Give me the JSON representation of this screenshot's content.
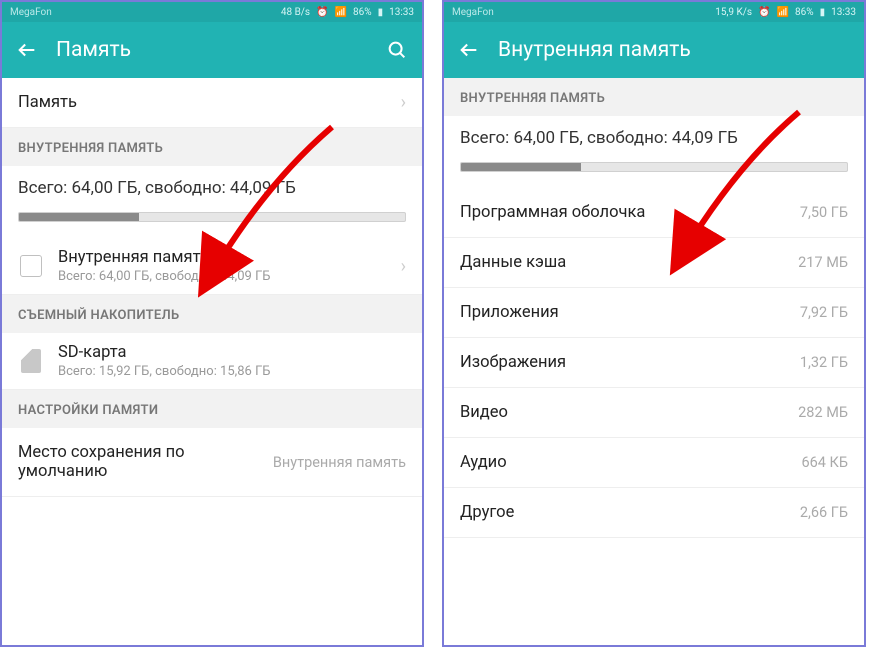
{
  "left": {
    "statusbar": {
      "carrier": "MegaFon",
      "speed": "48 B/s",
      "battery": "86%",
      "time": "13:33"
    },
    "header": {
      "title": "Память"
    },
    "row_memory": {
      "label": "Память"
    },
    "section_internal": "ВНУТРЕННЯЯ ПАМЯТЬ",
    "summary": "Всего: 64,00 ГБ, свободно: 44,09 ГБ",
    "progress_pct": 31,
    "internal_item": {
      "title": "Внутренняя память",
      "sub": "Всего: 64,00 ГБ, свободно: 44,09 ГБ"
    },
    "section_removable": "СЪЕМНЫЙ НАКОПИТЕЛЬ",
    "sd_item": {
      "title": "SD-карта",
      "sub": "Всего: 15,92 ГБ, свободно: 15,86 ГБ"
    },
    "section_settings": "НАСТРОЙКИ ПАМЯТИ",
    "default_loc": {
      "title": "Место сохранения по умолчанию",
      "value": "Внутренняя память"
    }
  },
  "right": {
    "statusbar": {
      "carrier": "MegaFon",
      "speed": "15,9 K/s",
      "battery": "86%",
      "time": "13:33"
    },
    "header": {
      "title": "Внутренняя память"
    },
    "section_internal": "ВНУТРЕННЯЯ ПАМЯТЬ",
    "summary": "Всего: 64,00 ГБ, свободно: 44,09 ГБ",
    "progress_pct": 31,
    "items": [
      {
        "label": "Программная оболочка",
        "value": "7,50 ГБ"
      },
      {
        "label": "Данные кэша",
        "value": "217 МБ"
      },
      {
        "label": "Приложения",
        "value": "7,92 ГБ"
      },
      {
        "label": "Изображения",
        "value": "1,32 ГБ"
      },
      {
        "label": "Видео",
        "value": "282 МБ"
      },
      {
        "label": "Аудио",
        "value": "664 КБ"
      },
      {
        "label": "Другое",
        "value": "2,66 ГБ"
      }
    ]
  }
}
